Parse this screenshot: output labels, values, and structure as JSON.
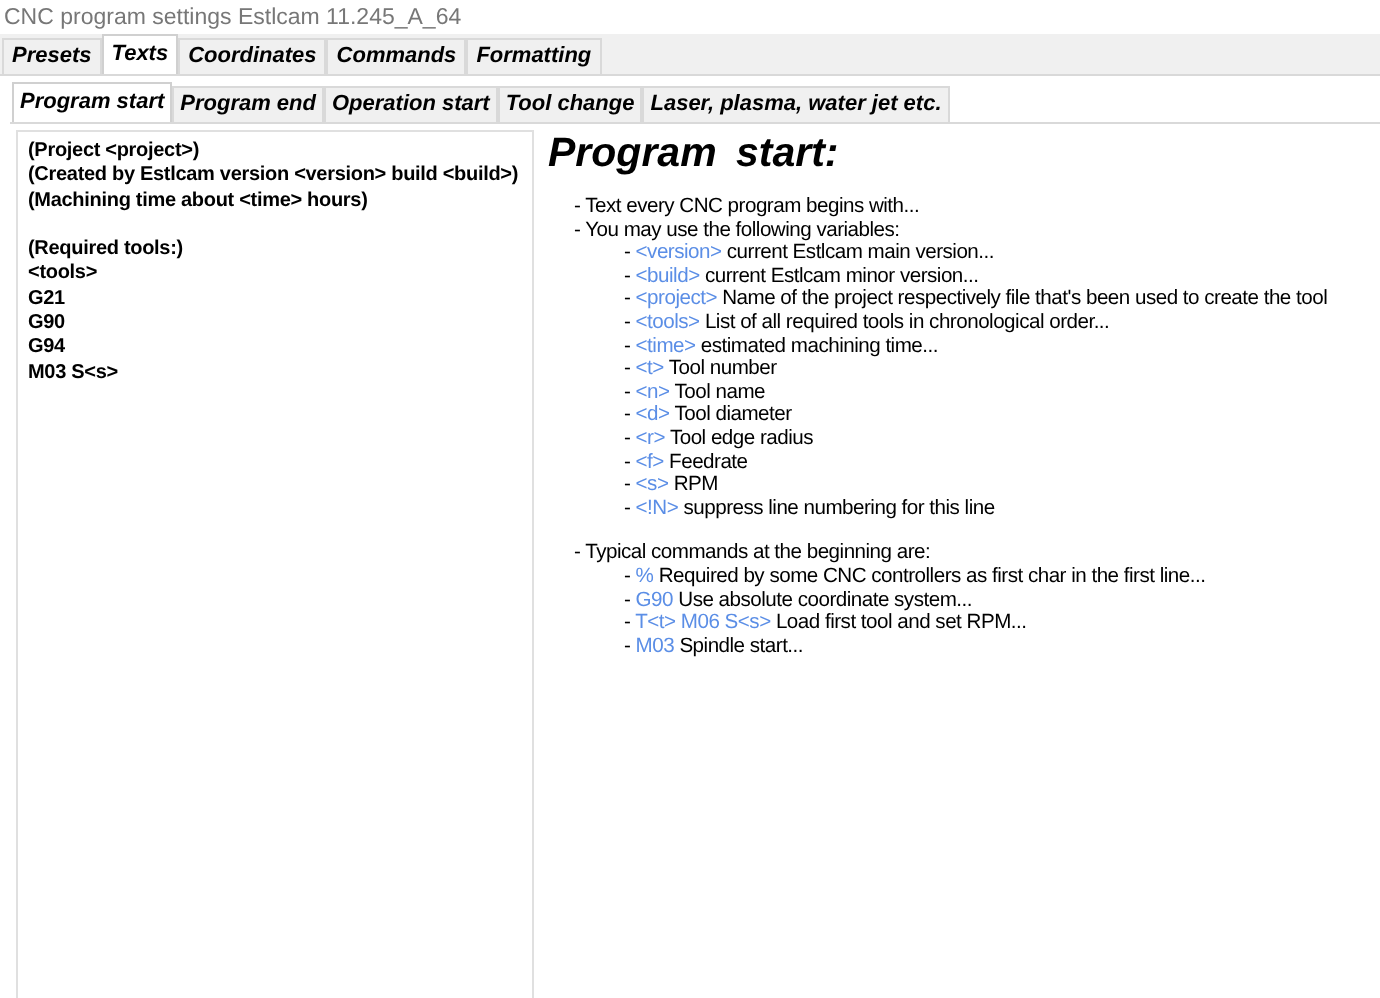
{
  "window": {
    "title": "CNC program settings Estlcam 11.245_A_64"
  },
  "tabs": [
    {
      "label": "Presets",
      "selected": false
    },
    {
      "label": "Texts",
      "selected": true
    },
    {
      "label": "Coordinates",
      "selected": false
    },
    {
      "label": "Commands",
      "selected": false
    },
    {
      "label": "Formatting",
      "selected": false
    }
  ],
  "subtabs": [
    {
      "label": "Program start",
      "selected": true
    },
    {
      "label": "Program end",
      "selected": false
    },
    {
      "label": "Operation start",
      "selected": false
    },
    {
      "label": "Tool change",
      "selected": false
    },
    {
      "label": "Laser, plasma, water jet etc.",
      "selected": false
    }
  ],
  "editor": {
    "value": "(Project <project>)\n(Created by Estlcam version <version> build <build>)\n(Machining time about <time> hours)\n\n(Required tools:)\n<tools>\nG21\nG90\nG94\nM03 S<s>"
  },
  "help": {
    "heading": "Program  start:",
    "sections": [
      {
        "lines": [
          {
            "marker": "-",
            "text": "Text every CNC program begins with..."
          },
          {
            "marker": "-",
            "text": "You may use the following variables:"
          }
        ],
        "items": [
          {
            "marker": "-",
            "code": "<version>",
            "text": "current Estlcam main version..."
          },
          {
            "marker": "-",
            "code": "<build>",
            "text": " current Estlcam minor version..."
          },
          {
            "marker": "-",
            "code": "<project>",
            "text": "Name of the project respectively file that's  been used to create the tool"
          },
          {
            "marker": "-",
            "code": "<tools>",
            "text": "List of all required tools in chronological order..."
          },
          {
            "marker": "-",
            "code": "<time>",
            "text": "estimated machining time..."
          },
          {
            "marker": "-",
            "code": "<t>",
            "text": "Tool number"
          },
          {
            "marker": "-",
            "code": "<n>",
            "text": "Tool name"
          },
          {
            "marker": "-",
            "code": "<d>",
            "text": "Tool diameter"
          },
          {
            "marker": "-",
            "code": "<r>",
            "text": "Tool edge radius"
          },
          {
            "marker": "-",
            "code": "<f>",
            "text": "Feedrate"
          },
          {
            "marker": "-",
            "code": "<s>",
            "text": "RPM"
          },
          {
            "marker": "-",
            "code": "<!N>",
            "text": "suppress line numbering for this line"
          }
        ]
      },
      {
        "lines": [
          {
            "marker": "-",
            "text": "Typical commands at the beginning are:"
          }
        ],
        "items": [
          {
            "marker": "-",
            "code": "%",
            "text": "Required by some CNC controllers as first char in the first line..."
          },
          {
            "marker": "-",
            "code": "G90",
            "text": "Use absolute coordinate system..."
          },
          {
            "marker": "-",
            "code": "T<t>  M06  S<s>",
            "text": "Load first tool and set RPM..."
          },
          {
            "marker": "-",
            "code": "M03",
            "text": "Spindle start..."
          }
        ]
      }
    ]
  }
}
